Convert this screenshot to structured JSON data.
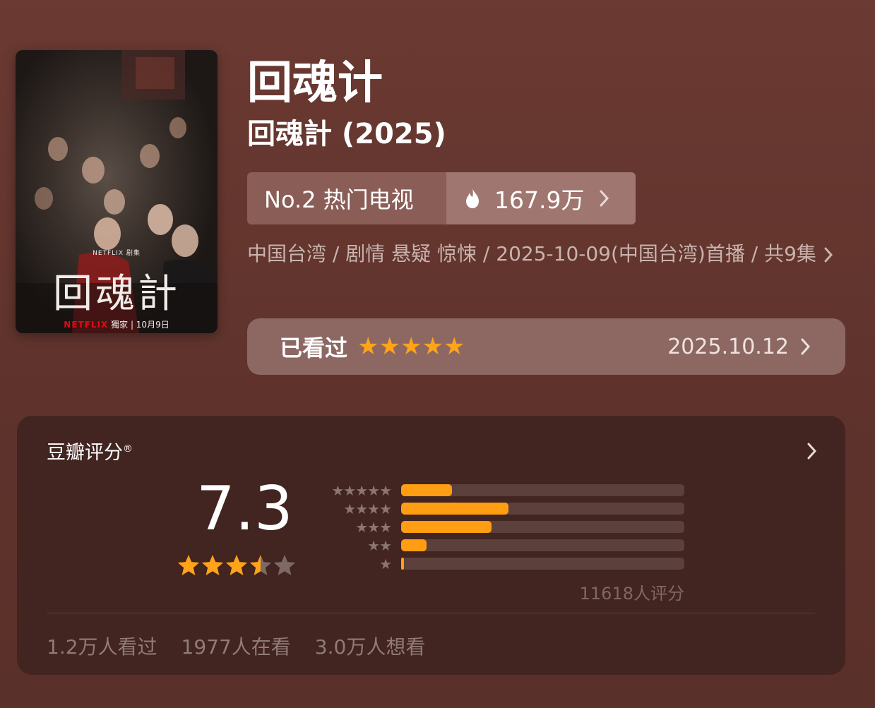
{
  "poster": {
    "title": "回魂計",
    "netflix_label": "NETFLIX 剧集",
    "netflix_brand": "NETFLIX",
    "footer_text": "獨家 | 10月9日"
  },
  "title": {
    "main": "回魂计",
    "original": "回魂計 (2025)"
  },
  "rank": {
    "label": "No.2 热门电视",
    "heat": "167.9万"
  },
  "meta": {
    "text": "中国台湾 / 剧情 悬疑 惊悚 / 2025-10-09(中国台湾)首播 / 共9集"
  },
  "watched": {
    "label": "已看过",
    "stars": "★★★★★",
    "rating": 5,
    "date": "2025.10.12"
  },
  "douban": {
    "title": "豆瓣评分",
    "registered": "®",
    "score": "7.3",
    "star_rating": 3.5,
    "distribution": [
      {
        "stars": "★★★★★",
        "percent": 18
      },
      {
        "stars": "★★★★",
        "percent": 38
      },
      {
        "stars": "★★★",
        "percent": 32
      },
      {
        "stars": "★★",
        "percent": 9
      },
      {
        "stars": "★",
        "percent": 1
      }
    ],
    "rating_count": "11618人评分",
    "stats": {
      "watched": "1.2万人看过",
      "watching": "1977人在看",
      "want": "3.0万人想看"
    }
  },
  "colors": {
    "accent_star": "#ffa31a",
    "bar_fill": "#ff9d13",
    "background": "#6b3a32"
  },
  "icons": {
    "heat": "flame-icon",
    "more": "chevron-right-icon"
  }
}
